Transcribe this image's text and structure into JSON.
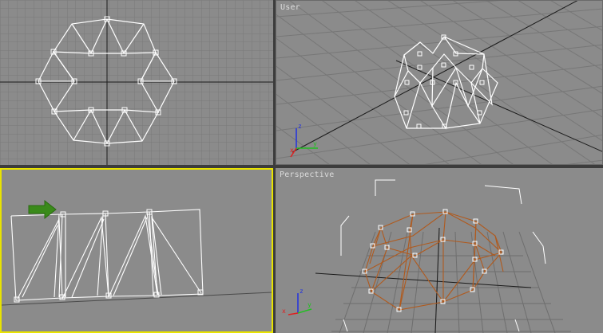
{
  "viewports": {
    "top": {
      "label": ""
    },
    "user": {
      "label": "User"
    },
    "front": {
      "label": ""
    },
    "perspective": {
      "label": "Perspective"
    }
  },
  "axis_tripod": {
    "x_label": "x",
    "y_label": "y",
    "z_label": "z"
  },
  "colors": {
    "viewport_bg": "#8b8b8b",
    "grid_line": "#7a7a7a",
    "grid_major": "#5a5a5a",
    "wire_white": "#ffffff",
    "wire_selected": "#b05a1e",
    "active_border": "#e9e400",
    "arrow_green": "#3a8a1a",
    "axis_x": "#e02020",
    "axis_y": "#20c020",
    "axis_z": "#2030e0"
  },
  "active_viewport": "front",
  "annotation": {
    "icon": "green-arrow-icon"
  }
}
